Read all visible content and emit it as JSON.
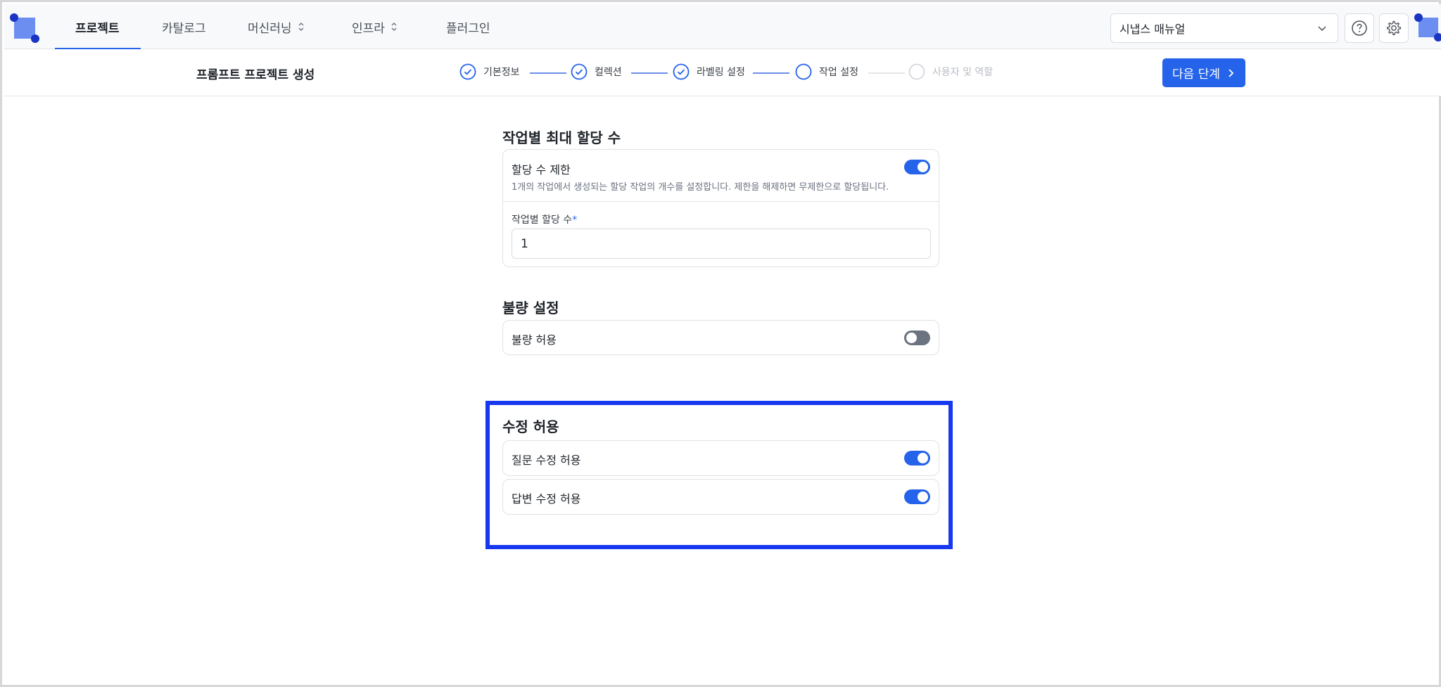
{
  "nav": {
    "tabs": [
      {
        "label": "프로젝트",
        "active": true
      },
      {
        "label": "카탈로그"
      },
      {
        "label": "머신러닝"
      },
      {
        "label": "인프라"
      },
      {
        "label": "플러그인"
      }
    ],
    "manual_select": "시냅스 매뉴얼"
  },
  "stepbar": {
    "title": "프롬프트 프로젝트 생성",
    "steps": [
      {
        "label": "기본정보",
        "state": "done"
      },
      {
        "label": "컬렉션",
        "state": "done"
      },
      {
        "label": "라벨링 설정",
        "state": "done"
      },
      {
        "label": "작업 설정",
        "state": "current"
      },
      {
        "label": "사용자 및 역할",
        "state": "disabled"
      }
    ],
    "next_label": "다음 단계"
  },
  "max_assign": {
    "title": "작업별 최대 할당 수",
    "limit_label": "할당 수 제한",
    "limit_desc": "1개의 작업에서 생성되는 할당 작업의 개수를 설정합니다. 제한을 해제하면 무제한으로 할당됩니다.",
    "limit_enabled": true,
    "count_label": "작업별 할당 수",
    "count_required": "*",
    "count_value": "1"
  },
  "defect": {
    "title": "불량 설정",
    "allow_label": "불량 허용",
    "allow_enabled": false
  },
  "edit": {
    "title": "수정 허용",
    "question_label": "질문 수정 허용",
    "question_enabled": true,
    "answer_label": "답변 수정 허용",
    "answer_enabled": true
  },
  "colors": {
    "accent": "#2563eb",
    "highlight": "#1838f0",
    "toggle_off": "#6b7280"
  }
}
